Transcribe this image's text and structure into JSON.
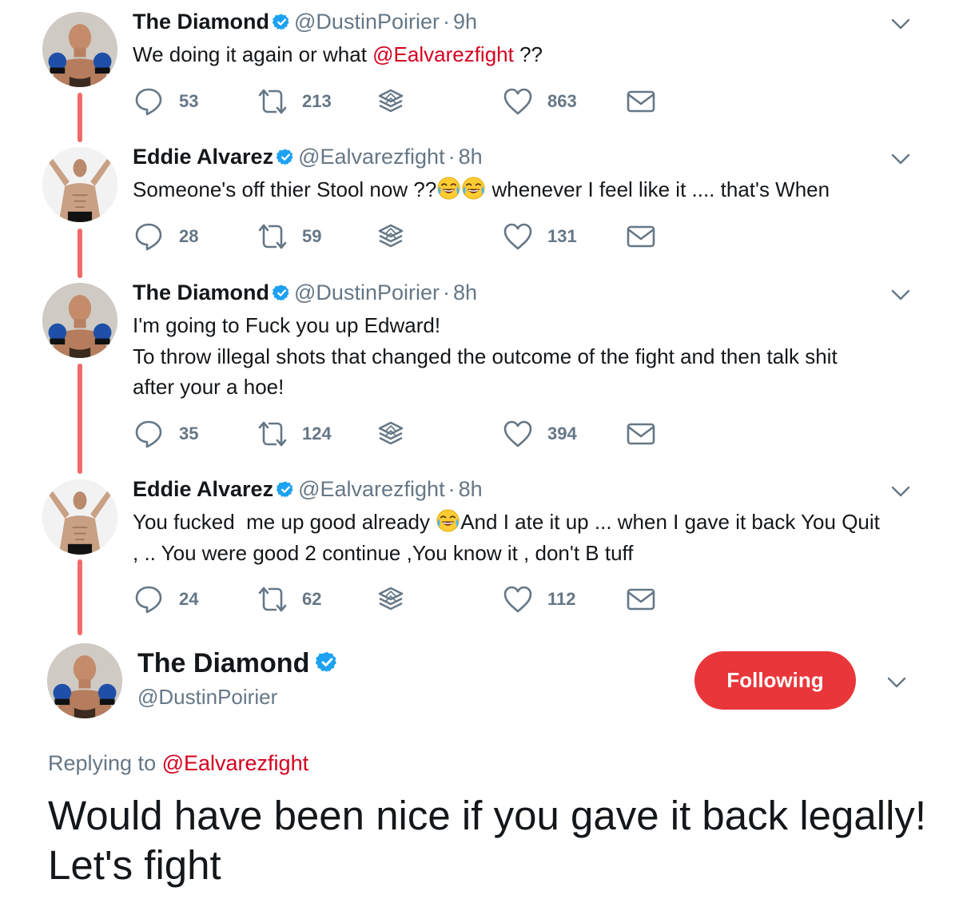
{
  "colors": {
    "accent": "#e8363a",
    "thread_line": "#f06b6b",
    "mention": "#d4001f",
    "verified": "#1da1f2",
    "muted": "#657786"
  },
  "tweets": [
    {
      "name": "The Diamond",
      "handle": "@DustinPoirier",
      "time": "9h",
      "text_parts": [
        "We doing it again or what ",
        "@Ealvarezfight",
        " ??"
      ],
      "counts": {
        "replies": "53",
        "retweets": "213",
        "likes": "863"
      }
    },
    {
      "name": "Eddie Alvarez",
      "handle": "@Ealvarezfight",
      "time": "8h",
      "text_parts": [
        "Someone's off thier Stool now ??",
        " whenever I feel like it .... that's When"
      ],
      "counts": {
        "replies": "28",
        "retweets": "59",
        "likes": "131"
      }
    },
    {
      "name": "The Diamond",
      "handle": "@DustinPoirier",
      "time": "8h",
      "text_lines": [
        "I'm going to Fuck you up Edward!",
        "To throw illegal shots that changed the outcome of the fight and then talk shit after your a hoe!"
      ],
      "counts": {
        "replies": "35",
        "retweets": "124",
        "likes": "394"
      }
    },
    {
      "name": "Eddie Alvarez",
      "handle": "@Ealvarezfight",
      "time": "8h",
      "text_parts": [
        "You fucked  me up good already ",
        "And I ate it up ... when I gave it back You Quit , .. You were good 2 continue ,You know it , don't B tuff"
      ],
      "counts": {
        "replies": "24",
        "retweets": "62",
        "likes": "112"
      }
    }
  ],
  "main_tweet": {
    "name": "The Diamond",
    "handle": "@DustinPoirier",
    "follow_label": "Following",
    "replying_prefix": "Replying to ",
    "replying_handle": "@Ealvarezfight",
    "text": "Would have been nice if you gave it back legally! Let's fight"
  },
  "icons": {
    "reply": "reply-icon",
    "retweet": "retweet-icon",
    "stack": "stack-icon",
    "like": "heart-icon",
    "dm": "envelope-icon",
    "caret": "chevron-down-icon",
    "verified": "verified-badge-icon",
    "emoji": "face-with-tears-of-joy-emoji"
  }
}
